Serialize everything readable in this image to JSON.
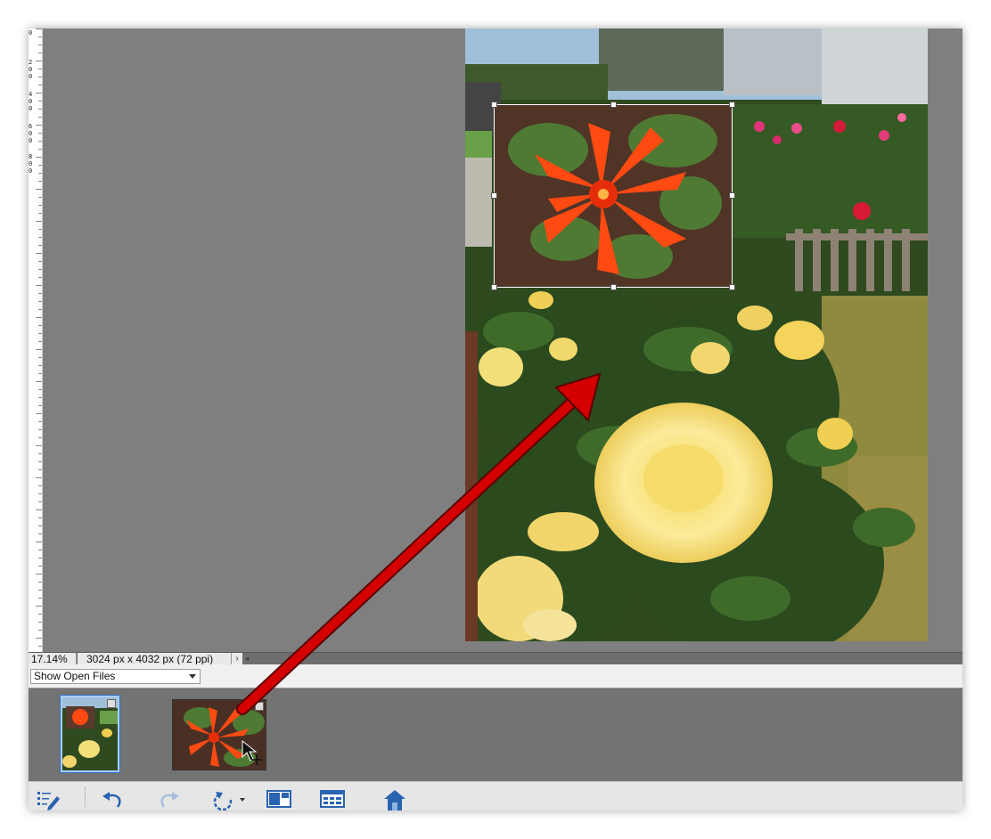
{
  "status": {
    "zoom": "17.14%",
    "dimensions": "3024 px x 4032 px (72 ppi)"
  },
  "ruler": {
    "labels": [
      "0",
      "2\n0\n0",
      "4\n0\n0",
      "6\n0\n0",
      "8\n0\n0"
    ]
  },
  "project_bin": {
    "dropdown_value": "Show Open Files",
    "thumbnails": [
      "garden-roses-photo",
      "orange-flower-photo"
    ]
  },
  "toolbar": {
    "items": [
      "tool-options-icon",
      "undo-icon",
      "redo-icon",
      "rotate-icon",
      "layout-icon",
      "organizer-icon",
      "home-screen-icon"
    ]
  },
  "colors": {
    "workspace": "#7f7f7f",
    "annotation_arrow": "#d40000",
    "thumb_selected": "#2f6fc2"
  }
}
